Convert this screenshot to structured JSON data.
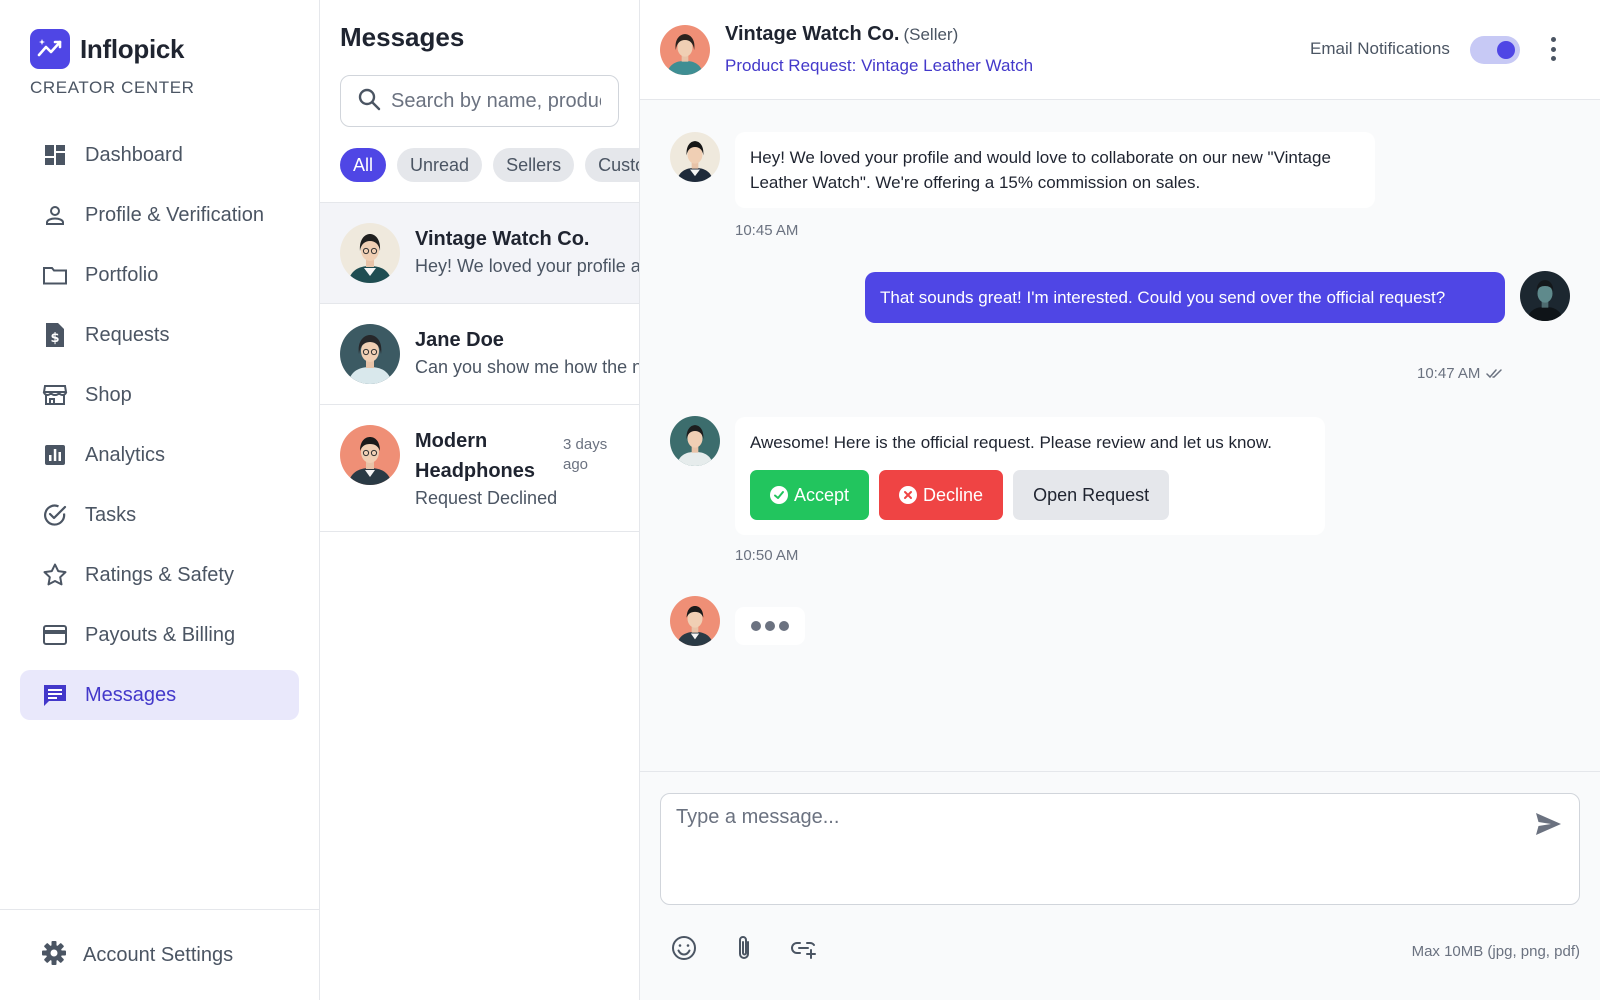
{
  "brand": {
    "name": "Inflopick",
    "subtitle": "CREATOR CENTER"
  },
  "nav": {
    "items": [
      {
        "label": "Dashboard",
        "icon": "dashboard-icon"
      },
      {
        "label": "Profile & Verification",
        "icon": "person-icon"
      },
      {
        "label": "Portfolio",
        "icon": "folder-icon"
      },
      {
        "label": "Requests",
        "icon": "dollar-document-icon"
      },
      {
        "label": "Shop",
        "icon": "storefront-icon"
      },
      {
        "label": "Analytics",
        "icon": "bar-chart-icon"
      },
      {
        "label": "Tasks",
        "icon": "check-circle-icon"
      },
      {
        "label": "Ratings & Safety",
        "icon": "star-icon"
      },
      {
        "label": "Payouts & Billing",
        "icon": "credit-card-icon"
      },
      {
        "label": "Messages",
        "icon": "chat-icon",
        "active": true
      }
    ],
    "settings_label": "Account Settings"
  },
  "conversations": {
    "title": "Messages",
    "search_placeholder": "Search by name, product...",
    "filters": [
      "All",
      "Unread",
      "Sellers",
      "Customers"
    ],
    "active_filter": "All",
    "list": [
      {
        "name": "Vintage Watch Co.",
        "preview": "Hey! We loved your profile and would love to collaborate...",
        "time": "",
        "selected": true
      },
      {
        "name": "Jane Doe",
        "preview": "Can you show me how the new product works?",
        "time": ""
      },
      {
        "name": "Modern Headphones",
        "name_line1": "Modern",
        "name_line2": "Headphones",
        "preview": "Request Declined",
        "time": "3 days ago",
        "time_line1": "3 days",
        "time_line2": "ago"
      }
    ]
  },
  "chat": {
    "contact_name": "Vintage Watch Co.",
    "contact_role": "(Seller)",
    "subject_link": "Product Request: Vintage Leather Watch",
    "email_notifications_label": "Email Notifications",
    "email_notifications_on": true,
    "messages": [
      {
        "from": "seller",
        "text": "Hey! We loved your profile and would love to collaborate on our new \"Vintage Leather Watch\". We're offering a 15% commission on sales.",
        "time": "10:45 AM"
      },
      {
        "from": "me",
        "text": "That sounds great! I'm interested. Could you send over the official request?",
        "time": "10:47 AM",
        "read": true
      },
      {
        "from": "seller",
        "text": "Awesome! Here is the official request. Please review and let us know.",
        "time": "10:50 AM",
        "actions": {
          "accept": "Accept",
          "decline": "Decline",
          "open": "Open Request"
        }
      }
    ],
    "typing_indicator": true,
    "composer": {
      "placeholder": "Type a message...",
      "tools": [
        "emoji-icon",
        "paperclip-icon",
        "link-icon"
      ],
      "limit_note": "Max 10MB (jpg, png, pdf)"
    }
  },
  "colors": {
    "accent": "#4f46e5",
    "accent_soft": "#e9e8fb",
    "accept": "#22c55e",
    "decline": "#ef4444",
    "background": "#f9fafb"
  }
}
